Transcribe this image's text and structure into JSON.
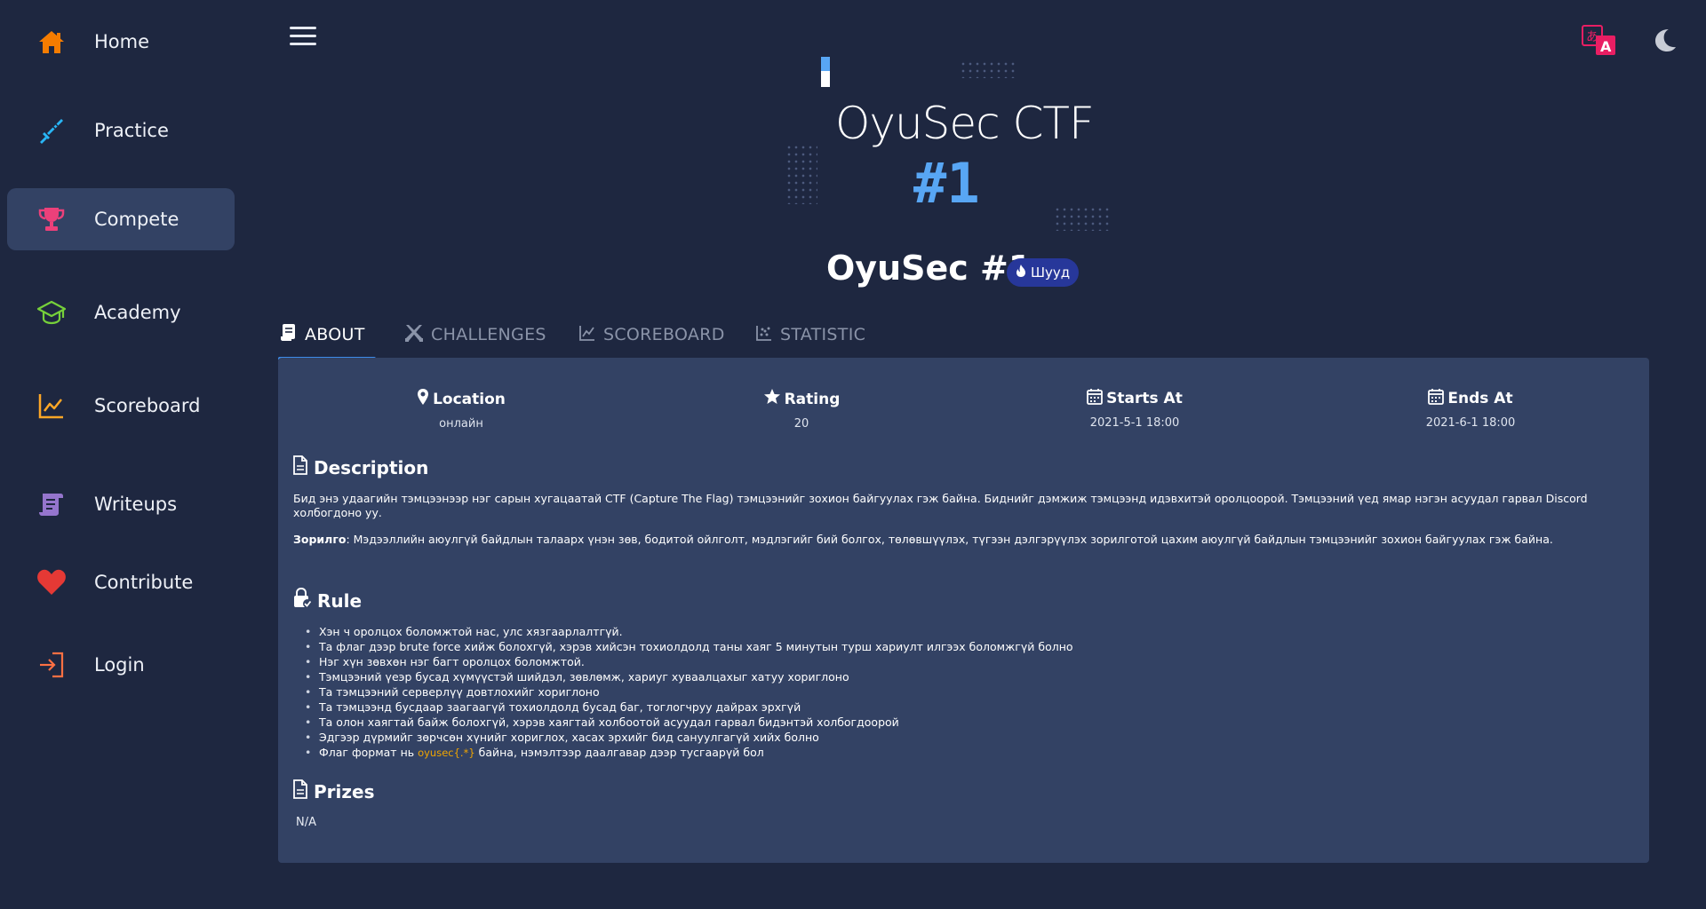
{
  "sidebar": {
    "items": [
      {
        "label": "Home",
        "icon": "home-icon",
        "color": "#f57c00"
      },
      {
        "label": "Practice",
        "icon": "sword-icon",
        "color": "#29b6f6"
      },
      {
        "label": "Compete",
        "icon": "trophy-icon",
        "color": "#ec407a",
        "active": true
      },
      {
        "label": "Academy",
        "icon": "graduation-cap-icon",
        "color": "#76d03a"
      },
      {
        "label": "Scoreboard",
        "icon": "chart-line-icon",
        "color": "#ffa726"
      },
      {
        "label": "Writeups",
        "icon": "scroll-icon",
        "color": "#9575cd"
      },
      {
        "label": "Contribute",
        "icon": "heart-icon",
        "color": "#e53935"
      },
      {
        "label": "Login",
        "icon": "login-icon",
        "color": "#ff7043"
      }
    ]
  },
  "banner": {
    "title": "OyuSec CTF",
    "number": "#1"
  },
  "event": {
    "title": "OyuSec #1",
    "badge": "Шууд"
  },
  "tabs": [
    {
      "label": "ABOUT",
      "active": true
    },
    {
      "label": "CHALLENGES"
    },
    {
      "label": "SCOREBOARD"
    },
    {
      "label": "STATISTIC"
    }
  ],
  "about": {
    "stats": [
      {
        "label": "Location",
        "value": "онлайн"
      },
      {
        "label": "Rating",
        "value": "20"
      },
      {
        "label": "Starts At",
        "value": "2021-5-1 18:00"
      },
      {
        "label": "Ends At",
        "value": "2021-6-1 18:00"
      }
    ],
    "description_heading": "Description",
    "description": "Бид энэ удаагийн тэмцээнээр нэг сарын хугацаатай CTF (Capture The Flag) тэмцээнийг зохион байгуулах гэж байна. Биднийг дэмжиж тэмцээнд идэвхитэй оролцоорой. Тэмцээний үед ямар нэгэн асуудал гарвал Discord холбогдоно уу.",
    "goal_label": "Зорилго",
    "goal": ": Мэдээллийн аюулгүй байдлын талаарх үнэн зөв, бодитой ойлголт, мэдлэгийг бий болгох, төлөвшүүлэх, түгээн дэлгэрүүлэх зорилготой цахим аюулгүй байдлын тэмцээнийг зохион байгуулах гэж байна.",
    "rule_heading": "Rule",
    "rules": [
      "Хэн ч оролцох боломжтой нас, улс хязгаарлалтгүй.",
      "Та флаг дээр brute force хийж болохгүй, хэрэв хийсэн тохиолдолд таны хаяг 5 минутын турш хариулт илгээх боломжгүй болно",
      "Нэг хүн зөвхөн нэг багт оролцох боломжтой.",
      "Тэмцээний үеэр бусад хүмүүстэй шийдэл, зөвлөмж, хариуг хуваалцахыг хатуу хориглоно",
      "Та тэмцээний серверлүү довтлохийг хориглоно",
      "Та тэмцээнд бусдаар заагаагүй тохиолдолд бусад баг, тоглогчруу дайрах эрхгүй",
      "Та олон хаягтай байж болохгүй, хэрэв хаягтай холбоотой асуудал гарвал бидэнтэй холбогдоорой",
      "Эдгээр дүрмийг зөрчсөн хүнийг хориглох, хасах эрхийг бид сануулгагүй хийх болно"
    ],
    "flag_rule_pre": "Флаг формат нь ",
    "flag_format": "oyusec{.*}",
    "flag_rule_post": " байна, нэмэлтээр даалгавар дээр тусгаарүй бол",
    "prizes_heading": "Prizes",
    "prizes": "N/A"
  },
  "colors": {
    "accent": "#3d8be8",
    "panel": "#334264",
    "bg": "#1e2740",
    "banner_number": "#58a6f4",
    "flag_format": "#f0a500"
  }
}
